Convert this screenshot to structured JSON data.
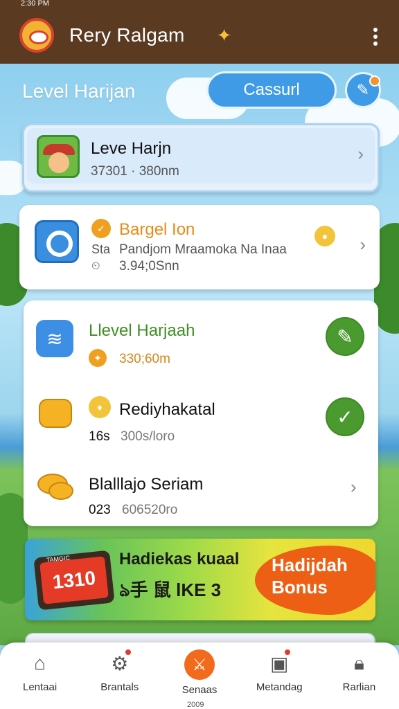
{
  "status_bar": {
    "time": "2:30 PM"
  },
  "app_bar": {
    "title": "Rery Ralgam"
  },
  "section": {
    "title": "Level Harijan",
    "casual_button": "Cassurl"
  },
  "card_level": {
    "title": "Leve Harjn",
    "subtitle": "37301 · 380nm"
  },
  "card_bargain": {
    "title": "Bargel Ion",
    "prefix": "Sta",
    "line1": "Pandjom Mraamoka Na Inaa",
    "line2": "3.94;0Snn"
  },
  "tasks": [
    {
      "title": "Llevel Harjaah",
      "subtitle": "330;60m",
      "status": "done",
      "title_color": "#3f8f23"
    },
    {
      "title": "Rediyhakatal",
      "prefix": "16s",
      "subtitle": "300s/loro",
      "status": "done",
      "title_color": "#111111"
    },
    {
      "title": "Blalllajo Seriam",
      "prefix": "023",
      "subtitle": "606520ro",
      "status": "open",
      "title_color": "#111111"
    }
  ],
  "banner": {
    "tablet_text": "1310",
    "tablet_small": "TAMGIC",
    "title": "Hadiekas kuaal",
    "subtitle": "ঌ手 鼠 lKE 3",
    "blob_line1": "Hadijdah",
    "blob_line2": "Bonus"
  },
  "bottom_nav": [
    {
      "label": "Lentaai",
      "icon": "home-icon",
      "active": false,
      "badge": false
    },
    {
      "label": "Brantals",
      "icon": "gear-icon",
      "active": false,
      "badge": true
    },
    {
      "label": "Senaas",
      "icon": "swords-icon",
      "active": true,
      "badge": false
    },
    {
      "label": "Metandag",
      "icon": "calendar-icon",
      "active": false,
      "badge": true
    },
    {
      "label": "Rarlian",
      "icon": "lock-icon",
      "active": false,
      "badge": false
    }
  ],
  "footer_extra": "2009",
  "colors": {
    "brown": "#5b3a22",
    "blue": "#3f9be6",
    "orange": "#f26a1c",
    "green": "#4a9a2f"
  }
}
